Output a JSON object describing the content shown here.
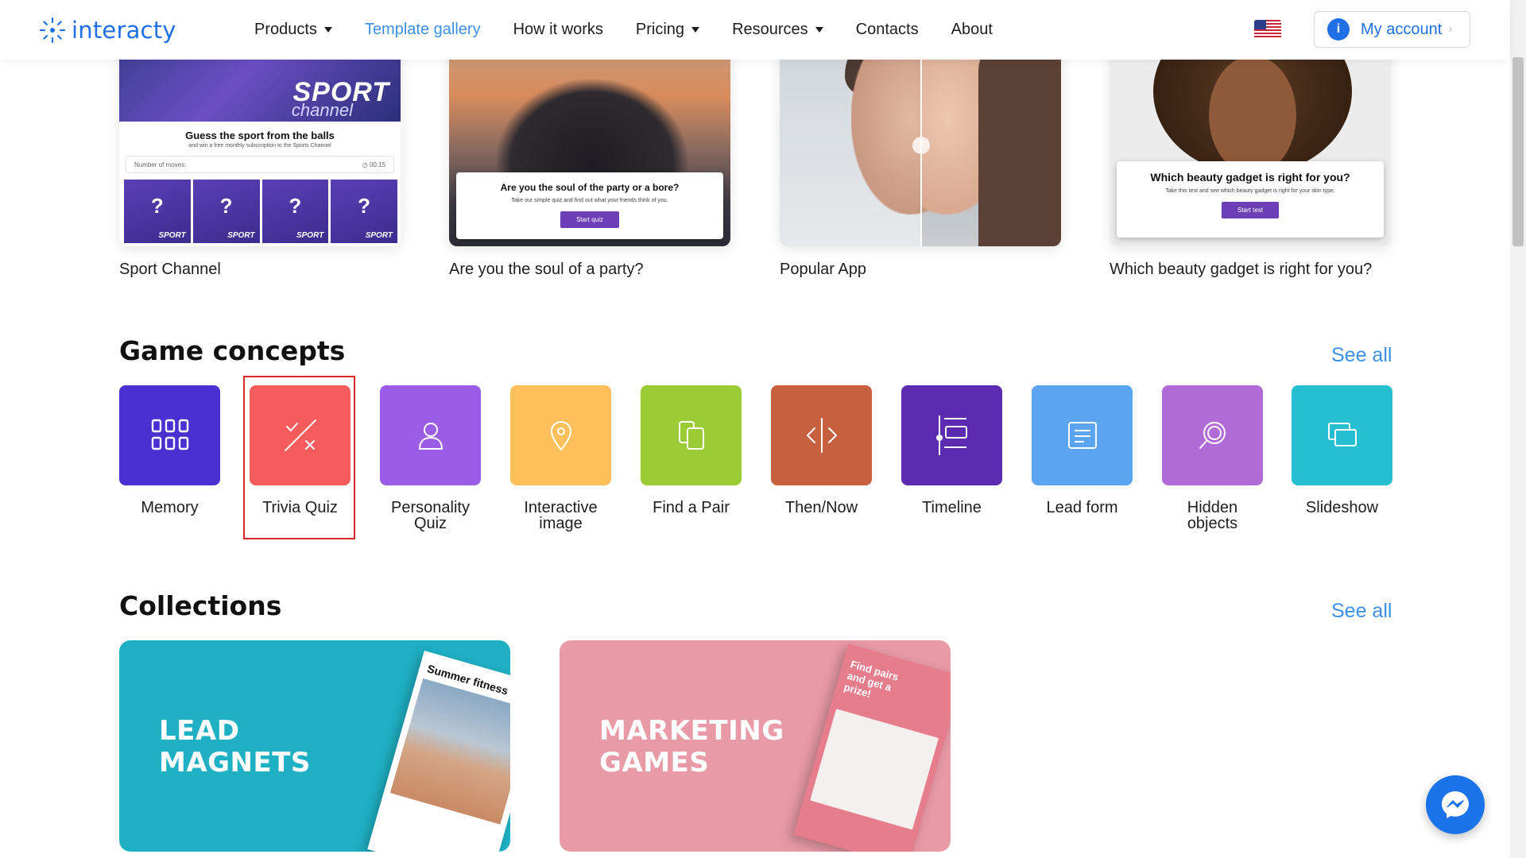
{
  "header": {
    "logo_text": "interacty",
    "nav": [
      {
        "label": "Products",
        "dropdown": true
      },
      {
        "label": "Template gallery",
        "active": true
      },
      {
        "label": "How it works"
      },
      {
        "label": "Pricing",
        "dropdown": true
      },
      {
        "label": "Resources",
        "dropdown": true
      },
      {
        "label": "Contacts"
      },
      {
        "label": "About"
      }
    ],
    "language_flag": "us-flag-icon",
    "account": {
      "icon_letter": "i",
      "label": "My account",
      "chevron": "›"
    }
  },
  "templates": [
    {
      "caption": "Sport Channel",
      "brand_word": "SPORT",
      "brand_sub": "channel",
      "title": "Guess the sport from the balls",
      "subtitle": "and win a free monthly subscription to the Sports Channel",
      "moves_label": "Number of moves:",
      "timer": "00:15",
      "tile_mark": "?",
      "tile_brand": "SPORT"
    },
    {
      "caption": "Are you the soul of a party?",
      "title": "Are you the soul of the party or a bore?",
      "text": "Take our simple quiz and find out what your friends think of you.",
      "button": "Start quiz"
    },
    {
      "caption": "Popular App"
    },
    {
      "caption": "Which beauty gadget is right for you?",
      "title": "Which beauty gadget is right for you?",
      "text": "Take this test and see which beauty gadget is right for your skin type.",
      "button": "Start test"
    }
  ],
  "game_concepts": {
    "title": "Game concepts",
    "see_all": "See all",
    "items": [
      {
        "label": "Memory",
        "color": "#4a2fd1",
        "icon": "grid-icon"
      },
      {
        "label": "Trivia Quiz",
        "color": "#f45b5b",
        "icon": "check-cross-icon",
        "highlighted": true
      },
      {
        "label": "Personality Quiz",
        "color": "#9b5de5",
        "icon": "person-icon"
      },
      {
        "label": "Interactive image",
        "color": "#ffc05c",
        "icon": "map-pin-icon"
      },
      {
        "label": "Find a Pair",
        "color": "#9ccc35",
        "icon": "cards-icon"
      },
      {
        "label": "Then/Now",
        "color": "#c7603e",
        "icon": "split-arrows-icon"
      },
      {
        "label": "Timeline",
        "color": "#5b2bb0",
        "icon": "timeline-icon"
      },
      {
        "label": "Lead form",
        "color": "#5ba4f0",
        "icon": "form-icon"
      },
      {
        "label": "Hidden objects",
        "color": "#b06bd6",
        "icon": "magnifier-icon"
      },
      {
        "label": "Slideshow",
        "color": "#26bfd1",
        "icon": "slides-icon"
      }
    ]
  },
  "collections": {
    "title": "Collections",
    "see_all": "See all",
    "items": [
      {
        "title_lines": [
          "LEAD",
          "MAGNETS"
        ],
        "color": "#1fb0c4",
        "mag_heading": "Summer fitness mar"
      },
      {
        "title_lines": [
          "MARKETING",
          "GAMES"
        ],
        "color": "#e89aa6",
        "mag_heading": "Find pairs and get a prize!"
      }
    ]
  },
  "messenger_icon": "messenger-icon"
}
